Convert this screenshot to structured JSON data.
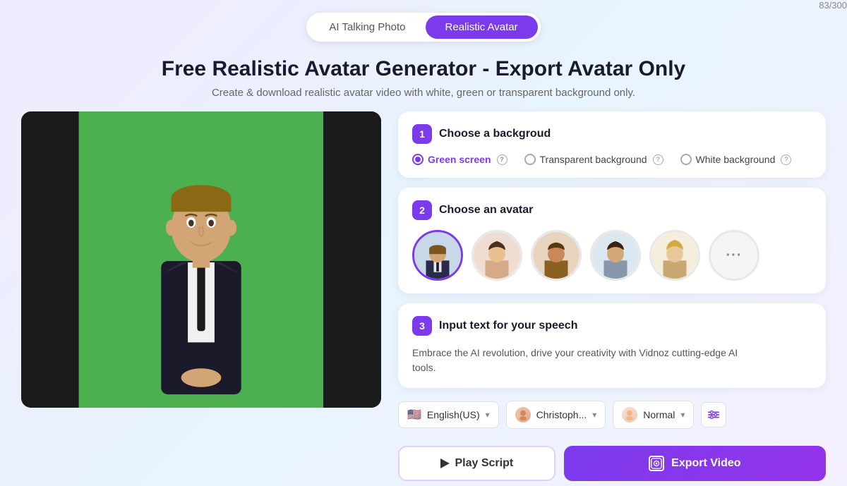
{
  "tabs": {
    "inactive": "AI Talking Photo",
    "active": "Realistic Avatar"
  },
  "hero": {
    "title": "Free Realistic Avatar Generator - Export Avatar Only",
    "subtitle": "Create & download realistic avatar video with white, green or transparent background only."
  },
  "step1": {
    "badge": "1",
    "title": "Choose a backgroud",
    "options": [
      {
        "id": "green",
        "label": "Green screen",
        "selected": true
      },
      {
        "id": "transparent",
        "label": "Transparent background",
        "selected": false
      },
      {
        "id": "white",
        "label": "White background",
        "selected": false
      }
    ]
  },
  "step2": {
    "badge": "2",
    "title": "Choose an avatar",
    "avatars": [
      {
        "id": "av1",
        "label": "Avatar 1",
        "selected": true
      },
      {
        "id": "av2",
        "label": "Avatar 2",
        "selected": false
      },
      {
        "id": "av3",
        "label": "Avatar 3",
        "selected": false
      },
      {
        "id": "av4",
        "label": "Avatar 4",
        "selected": false
      },
      {
        "id": "av5",
        "label": "Avatar 5",
        "selected": false
      }
    ],
    "more_label": "More"
  },
  "step3": {
    "badge": "3",
    "title": "Input text for your speech",
    "counter": "83/300",
    "text": "Embrace the AI revolution, drive your creativity with Vidnoz cutting-edge AI tools."
  },
  "controls": {
    "language": {
      "flag": "🇺🇸",
      "label": "English(US)",
      "chevron": "▾"
    },
    "voice": {
      "label": "Christoph...",
      "chevron": "▾"
    },
    "speed": {
      "label": "Normal",
      "chevron": "▾"
    }
  },
  "buttons": {
    "play_script": "Play Script",
    "export_video": "Export Video"
  }
}
